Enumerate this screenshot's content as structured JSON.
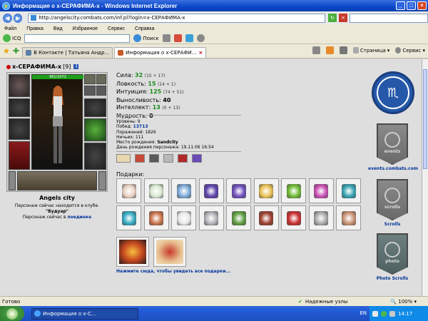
{
  "window": {
    "title": "Информация о x-СЕРАФИМА-x - Windows Internet Explorer"
  },
  "address": {
    "url": "http://angelscity.combats.com/inf.pl?login=x-СЕРАФИМА-x"
  },
  "menu": [
    "Файл",
    "Правка",
    "Вид",
    "Избранное",
    "Сервис",
    "Справка"
  ],
  "toolbar2": {
    "icq_label": "ICQ",
    "search_label": "Поиск"
  },
  "tabs": [
    {
      "label": "В Контакте | Татьяна Андр..."
    },
    {
      "label": "Информация о x-СЕРАФИ..."
    }
  ],
  "tab_tools": {
    "page_label": "Страница",
    "service_label": "Сервис"
  },
  "profile": {
    "nick": "x-СЕРАФИМА-x",
    "level_badge": "[9]",
    "info_icon": "i",
    "hp": "961/1072",
    "city": "Angels city",
    "presence_line1": "Персонаж сейчас находится в клубе.",
    "location": "\"Будуар\"",
    "presence_line2_prefix": "Персонаж сейчас в",
    "presence_line2_link": "поединке"
  },
  "stats": [
    {
      "name": "Сила:",
      "value": "32",
      "extra": "(15 + 17)",
      "green": true
    },
    {
      "name": "Ловкость:",
      "value": "15",
      "extra": "(14 + 1)",
      "green": true
    },
    {
      "name": "Интуиция:",
      "value": "125",
      "extra": "(74 + 51)",
      "green": true
    },
    {
      "name": "Выносливость:",
      "value": "40",
      "extra": "",
      "green": false
    },
    {
      "name": "Интеллект:",
      "value": "13",
      "extra": "(0 + 13)",
      "green": true
    },
    {
      "name": "Мудрость:",
      "value": "0",
      "extra": "",
      "green": false
    }
  ],
  "details": {
    "level_label": "Уровень:",
    "level": "9",
    "wins_label": "Побед:",
    "wins": "13713",
    "losses_label": "Поражений:",
    "losses": "1826",
    "draws_label": "Ничьих:",
    "draws": "111",
    "birthplace_label": "Место рождения:",
    "birthplace": "Sandcity",
    "birthday_label": "День рождения персонажа:",
    "birthday": "19.11.06 16:54"
  },
  "gifts": {
    "title": "Подарки:",
    "items": [
      "#e8d0c0",
      "#d8e8d0",
      "#7aa8d8",
      "#5a3ea8",
      "#6a4ab8",
      "#e8c050",
      "#6ab830",
      "#c84ab0",
      "#30a0b0",
      "#30a8c0",
      "#c87048",
      "#e8e8e8",
      "#b0b0b8",
      "#5a9a3a",
      "#9a3a2a",
      "#c82a2a",
      "#a8a8a8",
      "#c89070"
    ],
    "big_items": [
      "#c84a20",
      "#d8a070"
    ],
    "all_link": "Нажмите сюда, чтобы увидеть все подарки..."
  },
  "banners": {
    "events_flag": "events",
    "events_caption": "events.combats.com",
    "scrolls_flag": "scrolls",
    "scrolls_caption": "Scrolls",
    "photo_flag": "photo",
    "photo_caption": "Photo Scrolls"
  },
  "statusbar": {
    "left": "Готово",
    "zone": "Надежные узлы",
    "zoom": "100%"
  },
  "taskbar": {
    "task_label": "Информация о x-С...",
    "lang": "EN",
    "clock": "14:17"
  },
  "colors": {
    "accent_blue": "#2558a8",
    "stat_green": "#1a8a1a",
    "link_blue": "#003399"
  }
}
